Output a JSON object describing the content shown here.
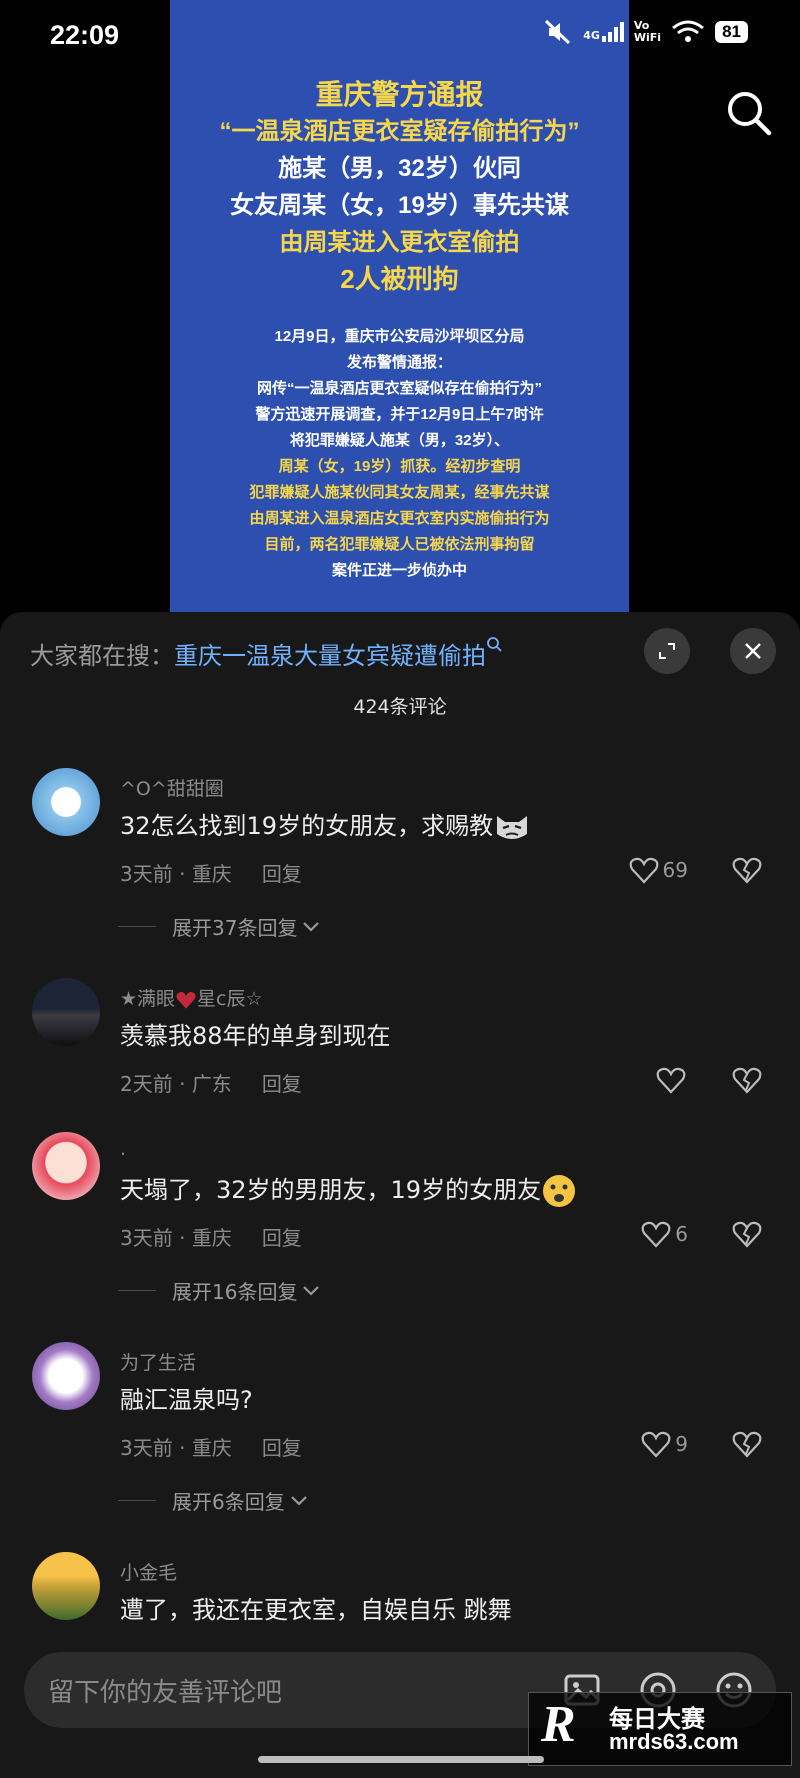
{
  "status": {
    "time": "22:09",
    "net_top": "4G",
    "net_vo": "Vo",
    "net_wifi": "WiFi",
    "battery": "81"
  },
  "video": {
    "headline": [
      "重庆警方通报",
      "“一温泉酒店更衣室疑存偷拍行为”",
      "施某（男，32岁）伙同",
      "女友周某（女，19岁）事先共谋",
      "由周某进入更衣室偷拍",
      "2人被刑拘"
    ],
    "body": [
      "12月9日，重庆市公安局沙坪坝区分局",
      "发布警情通报：",
      "网传“一温泉酒店更衣室疑似存在偷拍行为”",
      "警方迅速开展调查，并于12月9日上午7时许",
      "将犯罪嫌疑人施某（男，32岁）、",
      "周某（女，19岁）抓获。经初步查明",
      "犯罪嫌疑人施某伙同其女友周某，经事先共谋",
      "由周某进入温泉酒店女更衣室内实施偷拍行为",
      "目前，两名犯罪嫌疑人已被依法刑事拘留",
      "案件正进一步侦办中"
    ]
  },
  "sheet": {
    "hot_label": "大家都在搜：",
    "hot_keyword": "重庆一温泉大量女宾疑遭偷拍",
    "comment_count": "424条评论"
  },
  "comments": [
    {
      "user": "^O^甜甜圈",
      "text": "32怎么找到19岁的女朋友，求赐教",
      "time": "3天前",
      "loc": "重庆",
      "reply": "回复",
      "likes": "69",
      "expand": "展开37条回复"
    },
    {
      "user": "★满眼",
      "user_tail": "星c辰☆",
      "text": "羡慕我88年的单身到现在",
      "time": "2天前",
      "loc": "广东",
      "reply": "回复",
      "likes": "",
      "expand": ""
    },
    {
      "user": ".",
      "text": "天塌了，32岁的男朋友，19岁的女朋友",
      "time": "3天前",
      "loc": "重庆",
      "reply": "回复",
      "likes": "6",
      "expand": "展开16条回复"
    },
    {
      "user": "为了生活",
      "text": "融汇温泉吗?",
      "time": "3天前",
      "loc": "重庆",
      "reply": "回复",
      "likes": "9",
      "expand": "展开6条回复"
    },
    {
      "user": "小金毛",
      "text": "遭了，我还在更衣室，自娱自乐 跳舞"
    }
  ],
  "input": {
    "placeholder": "留下你的友善评论吧"
  },
  "watermark": {
    "line1": "每日大赛",
    "line2": "mrds63.com",
    "logo": "R"
  },
  "colors": {
    "accent_link": "#6fb1ff",
    "video_bg": "#2d4fb0",
    "highlight": "#f6d64a"
  }
}
